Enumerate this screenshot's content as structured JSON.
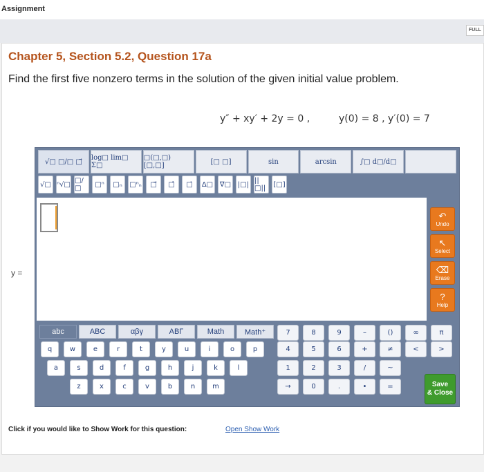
{
  "header": {
    "title": "Assignment",
    "full_label": "FULL"
  },
  "question": {
    "title": "Chapter 5, Section 5.2, Question 17a",
    "text": "Find the first five nonzero terms in the solution of the given initial value problem.",
    "equation": "y″ + xy′ + 2y = 0 ,",
    "initial_conditions": "y(0) = 8 , y′(0) = 7",
    "answer_label": "y ="
  },
  "editor": {
    "tabs": [
      "√□  □/□  □⃗",
      "log□ lim□ Σ□",
      "□(□,□) [□,□]",
      "[□ □]",
      "sin",
      "arcsin",
      "∫□ d□/d□",
      ""
    ],
    "symbols": [
      "√□",
      "ⁿ√□",
      "□/□",
      "□ⁿ",
      "□ₙ",
      "□ⁿₙ",
      "□⃗",
      "□̂",
      "□̇",
      "Δ□",
      "∇□",
      "|□|",
      "||□||",
      "[□]"
    ],
    "side_buttons": [
      {
        "icon": "↶",
        "label": "Undo"
      },
      {
        "icon": "↖",
        "label": "Select"
      },
      {
        "icon": "⌫",
        "label": "Erase"
      },
      {
        "icon": "?",
        "label": "Help"
      }
    ]
  },
  "keyboard": {
    "tabs": [
      "abc",
      "ABC",
      "αβγ",
      "ABΓ",
      "Math",
      "Math⁺"
    ],
    "row1": [
      "q",
      "w",
      "e",
      "r",
      "t",
      "y",
      "u",
      "i",
      "o",
      "p"
    ],
    "row2": [
      "a",
      "s",
      "d",
      "f",
      "g",
      "h",
      "j",
      "k",
      "l"
    ],
    "row3": [
      "z",
      "x",
      "c",
      "v",
      "b",
      "n",
      "m"
    ],
    "numrow1": [
      "7",
      "8",
      "9",
      "–",
      "()",
      "∞",
      "π"
    ],
    "numrow2": [
      "4",
      "5",
      "6",
      "+",
      "≠",
      "<",
      ">"
    ],
    "numrow3": [
      "1",
      "2",
      "3",
      "/",
      "~"
    ],
    "numrow4": [
      "→",
      "0",
      ".",
      "•",
      "="
    ],
    "save_line1": "Save",
    "save_line2": "& Close"
  },
  "footer": {
    "prompt": "Click if you would like to Show Work for this question:",
    "link": "Open Show Work"
  }
}
